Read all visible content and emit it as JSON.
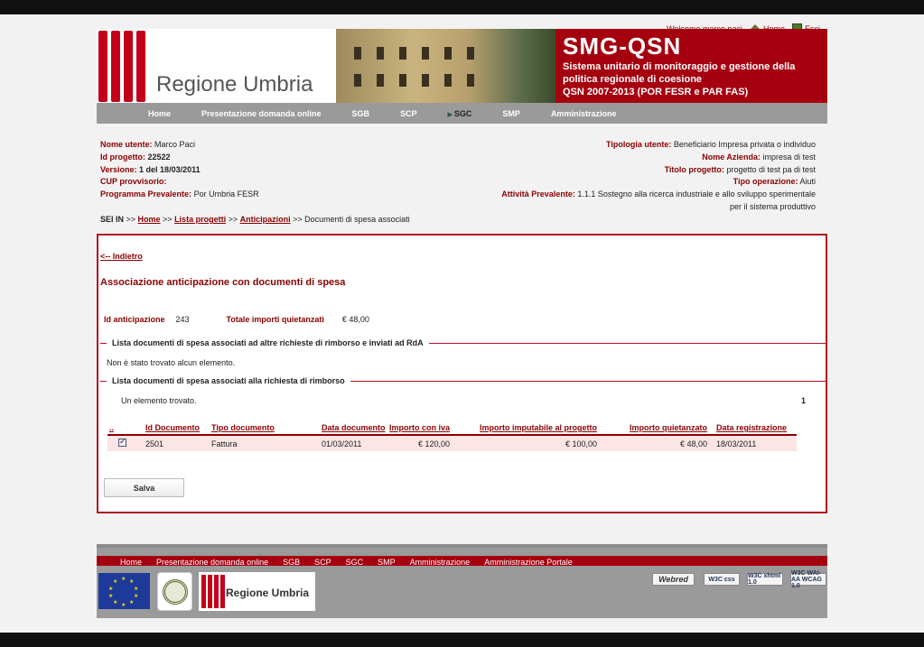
{
  "header": {
    "welcome": "Welcome marco paci",
    "home": "Home",
    "exit": "Esci"
  },
  "banner": {
    "region": "Regione Umbria",
    "app": "SMG-QSN",
    "sub1": "Sistema unitario di monitoraggio e gestione della",
    "sub2": "politica regionale di coesione",
    "sub3": "QSN 2007-2013 (POR FESR e PAR FAS)"
  },
  "nav": [
    "Home",
    "Presentazione domanda online",
    "SGB",
    "SCP",
    "SGC",
    "SMP",
    "Amministrazione"
  ],
  "info_left": [
    {
      "label": "Nome utente:",
      "value": "Marco Paci",
      "bold": false
    },
    {
      "label": "Id progetto:",
      "value": "22522",
      "bold": true
    },
    {
      "label": "Versione:",
      "value": "1 del 18/03/2011",
      "bold": true
    },
    {
      "label": "CUP provvisorio:",
      "value": "",
      "bold": false
    },
    {
      "label": "Programma Prevalente:",
      "value": "Por Umbria FESR",
      "bold": false
    }
  ],
  "info_right": [
    {
      "label": "Tipologia utente:",
      "value": "Beneficiario  Impresa privata o individuo"
    },
    {
      "label": "Nome Azienda:",
      "value": "impresa di test"
    },
    {
      "label": "Titolo progetto:",
      "value": "progetto di test pa di test"
    },
    {
      "label": "Tipo operazione:",
      "value": " Aiuti"
    },
    {
      "label": "Attività Prevalente:",
      "value": "1.1.1 Sostegno alla ricerca industriale e allo sviluppo sperimentale"
    },
    {
      "label": "",
      "value": "per il sistema produttivo"
    }
  ],
  "breadcrumb": {
    "prefix": "SEI IN",
    "links": [
      "Home",
      "Lista progetti",
      "Anticipazioni"
    ],
    "current": "Documenti di spesa associati"
  },
  "content": {
    "back": "<-- Indietro",
    "title": "Associazione anticipazione con documenti di spesa",
    "id_label": "Id anticipazione",
    "id_value": "243",
    "tot_label": "Totale importi quietanzati",
    "tot_value": "€ 48,00",
    "section1": "Lista documenti di spesa associati ad altre richieste di rimborso e inviati ad RdA",
    "no_items": "Non è stato trovato alcun elemento.",
    "section2": "Lista documenti di spesa associati alla richiesta di rimborso",
    "found": "Un elemento trovato.",
    "page": "1",
    "save": "Salva"
  },
  "table": {
    "headers": [
      "..",
      "Id Documento",
      "Tipo documento",
      "Data documento",
      "Importo con iva",
      "Importo imputabile al progetto",
      "Importo quietanzato",
      "Data registrazione"
    ],
    "rows": [
      {
        "checked": true,
        "id": "2501",
        "tipo": "Fattura",
        "data": "01/03/2011",
        "iva": "€ 120,00",
        "imputabile": "€ 100,00",
        "quietanzato": "€ 48,00",
        "registrazione": "18/03/2011"
      }
    ]
  },
  "footer_nav": [
    "Home",
    "Presentazione domanda online",
    "SGB",
    "SCP",
    "SGC",
    "SMP",
    "Amministrazione",
    "Amministrazione Portale"
  ],
  "footer": {
    "region": "Regione Umbria",
    "badges": [
      "Webred",
      "W3C css",
      "W3C xhtml 1.0",
      "W3C WAI-AA WCAG 1.0"
    ]
  }
}
